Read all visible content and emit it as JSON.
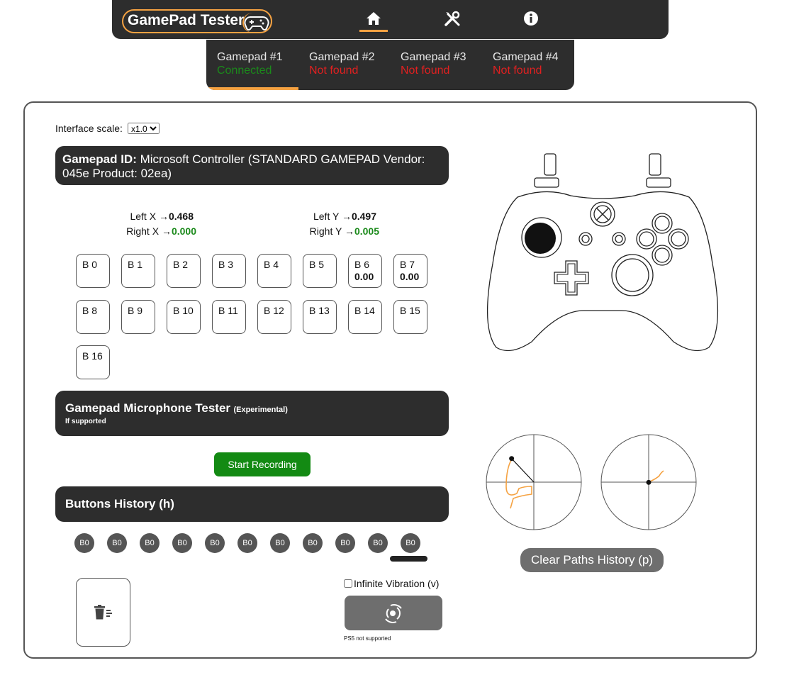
{
  "navbar": {
    "brand": "GamePad Tester",
    "brand_icon": "gamepad-icon",
    "nav_items": [
      {
        "icon": "home-icon"
      },
      {
        "icon": "tools-icon"
      },
      {
        "icon": "info-icon"
      }
    ],
    "accent_color": "#f5a242",
    "bg_color": "#2d2d2d"
  },
  "gamepad_tabs": [
    {
      "name": "Gamepad #1",
      "status": "Connected",
      "status_color": "#1b8a1b",
      "active": true
    },
    {
      "name": "Gamepad #2",
      "status": "Not found",
      "status_color": "#e02020",
      "active": false
    },
    {
      "name": "Gamepad #3",
      "status": "Not found",
      "status_color": "#e02020",
      "active": false
    },
    {
      "name": "Gamepad #4",
      "status": "Not found",
      "status_color": "#e02020",
      "active": false
    }
  ],
  "interface_scale": {
    "label": "Interface scale:",
    "value": "x1.0"
  },
  "gamepad_id": {
    "label": "Gamepad ID:",
    "value": "Microsoft Controller (STANDARD GAMEPAD Vendor: 045e Product: 02ea)"
  },
  "axes": {
    "left_x": {
      "label": "Left X",
      "arrow": "→",
      "value": "0.468"
    },
    "right_x": {
      "label": "Right X",
      "arrow": "→",
      "value": "0.000"
    },
    "left_y": {
      "label": "Left Y",
      "arrow": "→",
      "value": "0.497"
    },
    "right_y": {
      "label": "Right Y",
      "arrow": "→",
      "value": "0.005"
    }
  },
  "buttons": [
    {
      "label": "B 0",
      "value": ""
    },
    {
      "label": "B 1",
      "value": ""
    },
    {
      "label": "B 2",
      "value": ""
    },
    {
      "label": "B 3",
      "value": ""
    },
    {
      "label": "B 4",
      "value": ""
    },
    {
      "label": "B 5",
      "value": ""
    },
    {
      "label": "B 6",
      "value": "0.00"
    },
    {
      "label": "B 7",
      "value": "0.00"
    },
    {
      "label": "B 8",
      "value": ""
    },
    {
      "label": "B 9",
      "value": ""
    },
    {
      "label": "B 10",
      "value": ""
    },
    {
      "label": "B 11",
      "value": ""
    },
    {
      "label": "B 12",
      "value": ""
    },
    {
      "label": "B 13",
      "value": ""
    },
    {
      "label": "B 14",
      "value": ""
    },
    {
      "label": "B 15",
      "value": ""
    },
    {
      "label": "B 16",
      "value": ""
    }
  ],
  "microphone": {
    "title": "Gamepad Microphone Tester",
    "experimental": "(Experimental)",
    "subtitle": "If supported",
    "record_button": "Start Recording"
  },
  "history": {
    "title": "Buttons History (h)",
    "chips": [
      "B0",
      "B0",
      "B0",
      "B0",
      "B0",
      "B0",
      "B0",
      "B0",
      "B0",
      "B0",
      "B0"
    ],
    "clear_icon": "trash-list-icon"
  },
  "vibration": {
    "checkbox_label": "Infinite Vibration (v)",
    "checked": false,
    "button_icon": "vibration-icon",
    "note": "PS5 not supported"
  },
  "controller_image": "xbox-controller-outline",
  "sticks": {
    "left": {
      "x": -0.468,
      "y": -0.497
    },
    "right": {
      "x": 0.0,
      "y": 0.005
    }
  },
  "clear_paths_button": "Clear Paths History (p)"
}
